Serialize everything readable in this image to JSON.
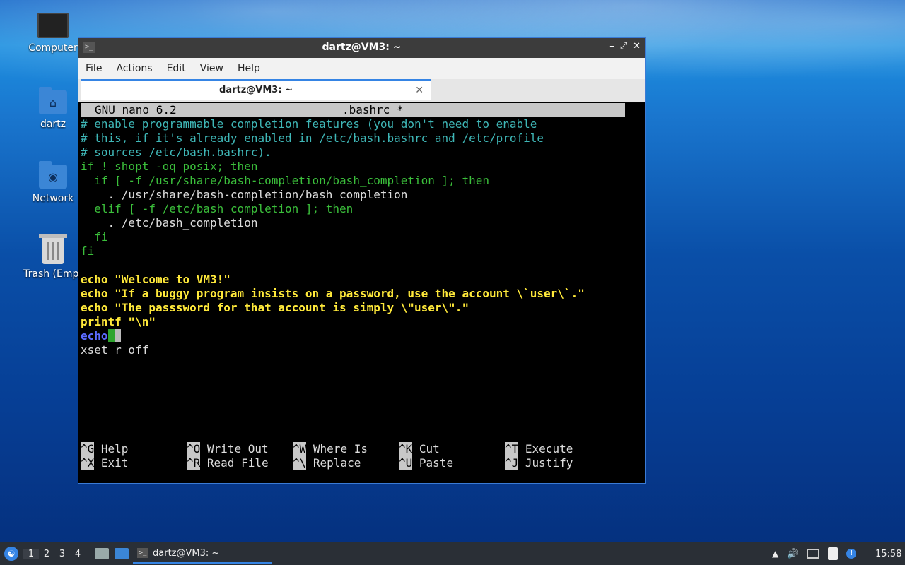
{
  "desktop": {
    "icons": [
      {
        "label": "Computer"
      },
      {
        "label": "dartz"
      },
      {
        "label": "Network"
      },
      {
        "label": "Trash (Empt"
      }
    ]
  },
  "window": {
    "title": "dartz@VM3: ~",
    "menu": [
      "File",
      "Actions",
      "Edit",
      "View",
      "Help"
    ],
    "tab_title": "dartz@VM3: ~"
  },
  "nano": {
    "version": "GNU nano 6.2",
    "filename": ".bashrc *",
    "lines": [
      "# enable programmable completion features (you don't need to enable",
      "# this, if it's already enabled in /etc/bash.bashrc and /etc/profile",
      "# sources /etc/bash.bashrc).",
      "if ! shopt -oq posix; then",
      "  if [ -f /usr/share/bash-completion/bash_completion ]; then",
      "    . /usr/share/bash-completion/bash_completion",
      "  elif [ -f /etc/bash_completion ]; then",
      "    . /etc/bash_completion",
      "  fi",
      "fi",
      "",
      "echo \"Welcome to VM3!\"",
      "echo \"If a buggy program insists on a password, use the account \\`user\\`.\"",
      "echo \"The passsword for that account is simply \\\"user\\\".\"",
      "printf \"\\n\"",
      "echo",
      "xset r off"
    ],
    "shortcuts": [
      {
        "key": "^G",
        "label": "Help"
      },
      {
        "key": "^O",
        "label": "Write Out"
      },
      {
        "key": "^W",
        "label": "Where Is"
      },
      {
        "key": "^K",
        "label": "Cut"
      },
      {
        "key": "^T",
        "label": "Execute"
      },
      {
        "key": "^X",
        "label": "Exit"
      },
      {
        "key": "^R",
        "label": "Read File"
      },
      {
        "key": "^\\",
        "label": "Replace"
      },
      {
        "key": "^U",
        "label": "Paste"
      },
      {
        "key": "^J",
        "label": "Justify"
      }
    ]
  },
  "taskbar": {
    "workspaces": [
      "1",
      "2",
      "3",
      "4"
    ],
    "task_label": "dartz@VM3: ~",
    "clock": "15:58"
  }
}
